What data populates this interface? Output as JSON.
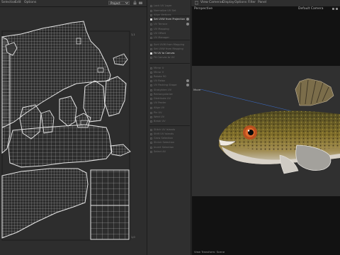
{
  "menu": {
    "uv_items": [
      "Selection",
      "Edit",
      "Options"
    ],
    "layout_dropdown": "Project",
    "viewport_items": [
      "View",
      "Cameras",
      "Display",
      "Options",
      "Filter",
      "Panel"
    ]
  },
  "viewport": {
    "perspective_label": "Perspective",
    "camera_label": "Default Camera",
    "move_label": "Move",
    "status_text": "View Transform: Scene"
  },
  "sidebar": {
    "items": [
      {
        "label": "Lock UV Layer",
        "active": false
      },
      {
        "label": "Normalize UV Set",
        "active": false
      },
      {
        "label": "Align Vertices",
        "active": false
      },
      {
        "label": "Set UVW from Projection",
        "active": true,
        "gear": true
      },
      {
        "label": "UV Terrace",
        "active": false,
        "gear": true
      },
      {
        "label": "UV Mapping",
        "active": false
      },
      {
        "label": "UV Offset",
        "active": false
      },
      {
        "label": "UV Manager",
        "active": false
      },
      {
        "label": "Sort UVW from Mapping",
        "active": false
      },
      {
        "label": "Set UVW from Mapping",
        "active": false
      },
      {
        "label": "Fit UV to Canvas",
        "active": true
      },
      {
        "label": "Fit Canvas to UV",
        "active": false
      },
      {
        "label": "Mirror U",
        "active": false
      },
      {
        "label": "Mirror V",
        "active": false
      },
      {
        "label": "Rotate 90",
        "active": false
      },
      {
        "label": "UV Relax",
        "active": false,
        "gear": true
      },
      {
        "label": "UV Packing Shape",
        "active": false,
        "gear": true
      },
      {
        "label": "Straighten UV",
        "active": false
      },
      {
        "label": "Rectangularize",
        "active": false
      },
      {
        "label": "Distribute UV",
        "active": false
      },
      {
        "label": "UV Peeler",
        "active": false
      },
      {
        "label": "Align UV",
        "active": false
      },
      {
        "label": "Pin UV",
        "active": false
      },
      {
        "label": "Weld UV",
        "active": false
      },
      {
        "label": "Break UV",
        "active": false
      },
      {
        "label": "Stitch UV Islands",
        "active": false
      },
      {
        "label": "Shift UV Islands",
        "active": false
      },
      {
        "label": "Grow Selection",
        "active": false
      },
      {
        "label": "Shrink Selection",
        "active": false
      },
      {
        "label": "Invert Selection",
        "active": false
      },
      {
        "label": "Select All",
        "active": false
      }
    ]
  },
  "uv_editor": {
    "tick_top": "1,1",
    "tick_bottom": "1,0"
  },
  "colors": {
    "menu_bg": "#2e2e2e",
    "panel_bg": "#2f2f2f",
    "uv_bg": "#2d2d2d",
    "viewport_bg": "#121212",
    "viewport_backdrop": "#303030",
    "uv_grid": "#bdbdbd"
  }
}
